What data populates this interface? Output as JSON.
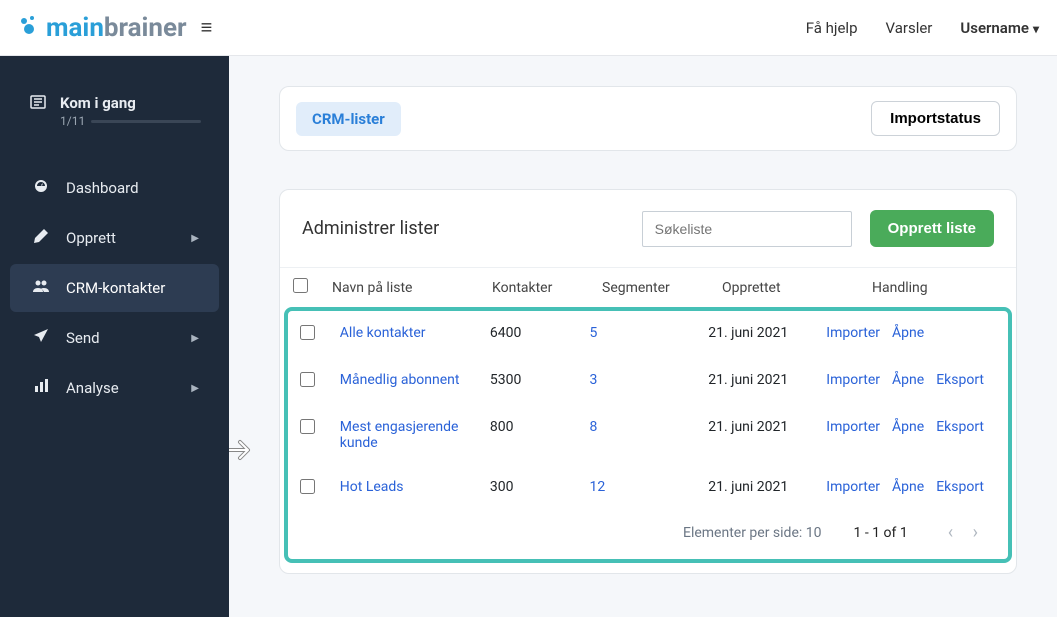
{
  "brand": {
    "part1": "main",
    "part2": "brainer"
  },
  "topnav": {
    "help": "Få hjelp",
    "alerts": "Varsler",
    "user": "Username"
  },
  "sidebar": {
    "start": {
      "label": "Kom i gang",
      "progress": "1/11"
    },
    "items": [
      {
        "label": "Dashboard",
        "has_chev": false
      },
      {
        "label": "Opprett",
        "has_chev": true
      },
      {
        "label": "CRM-kontakter",
        "has_chev": false,
        "active": true
      },
      {
        "label": "Send",
        "has_chev": true
      },
      {
        "label": "Analyse",
        "has_chev": true
      }
    ]
  },
  "header": {
    "tab": "CRM-lister",
    "import_status": "Importstatus"
  },
  "panel": {
    "title": "Administrer lister",
    "search_placeholder": "Søkeliste",
    "create": "Opprett liste"
  },
  "columns": {
    "name": "Navn på liste",
    "contacts": "Kontakter",
    "segments": "Segmenter",
    "created": "Opprettet",
    "action": "Handling"
  },
  "rows": [
    {
      "name": "Alle kontakter",
      "contacts": "6400",
      "segments": "5",
      "created": "21. juni 2021",
      "import": "Importer",
      "open": "Åpne",
      "export": ""
    },
    {
      "name": "Månedlig abonnent",
      "contacts": "5300",
      "segments": "3",
      "created": "21. juni 2021",
      "import": "Importer",
      "open": "Åpne",
      "export": "Eksport"
    },
    {
      "name": "Mest engasjerende kunde",
      "contacts": "800",
      "segments": "8",
      "created": "21. juni 2021",
      "import": "Importer",
      "open": "Åpne",
      "export": "Eksport"
    },
    {
      "name": "Hot Leads",
      "contacts": "300",
      "segments": "12",
      "created": "21. juni 2021",
      "import": "Importer",
      "open": "Åpne",
      "export": "Eksport"
    }
  ],
  "pager": {
    "per_page": "Elementer per side: 10",
    "range": "1 - 1 of 1"
  }
}
